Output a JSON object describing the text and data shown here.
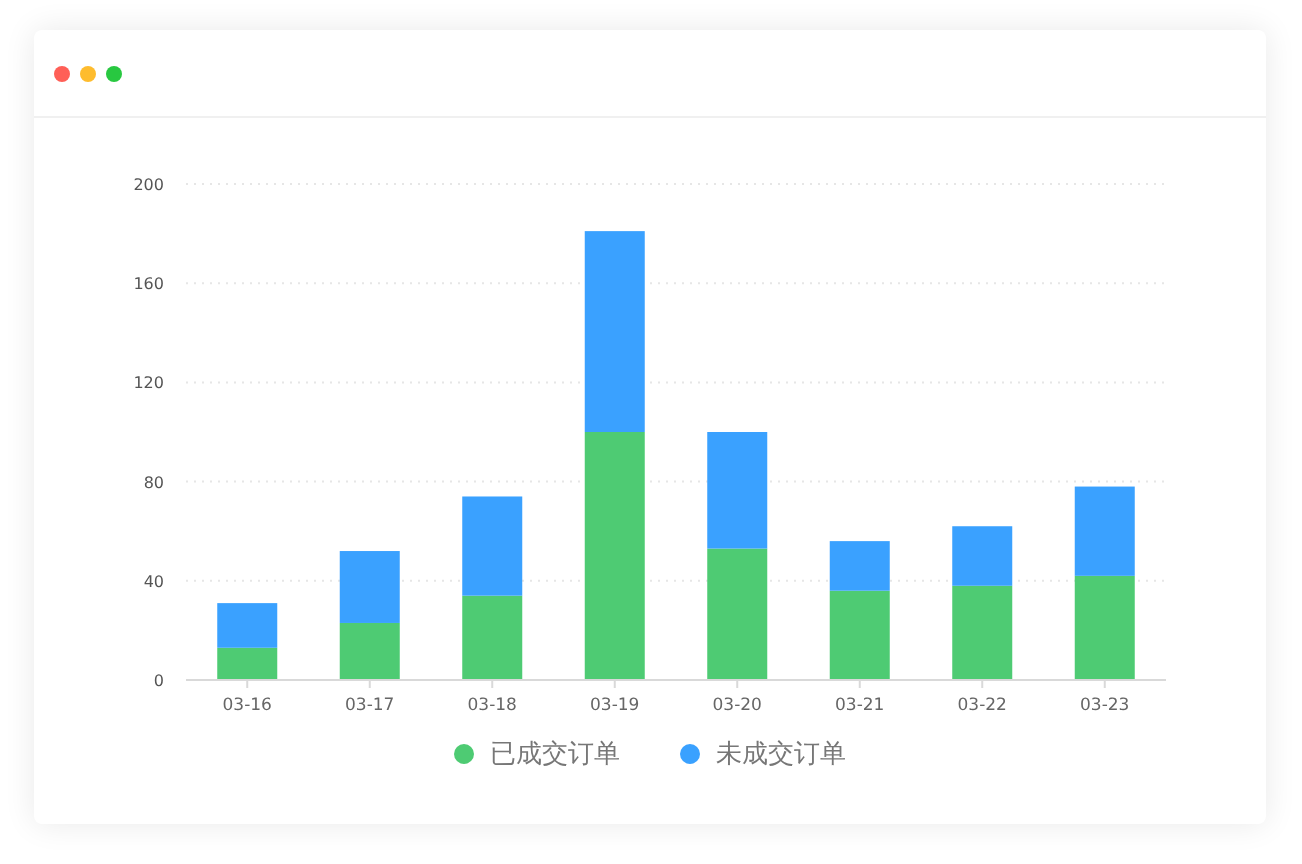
{
  "window": {
    "controls": [
      {
        "color": "#ff5f57"
      },
      {
        "color": "#febc2e"
      },
      {
        "color": "#28c840"
      }
    ]
  },
  "chart": {
    "chart_data": {
      "type": "bar",
      "stacked": true,
      "grid": true,
      "categories": [
        "03-16",
        "03-17",
        "03-18",
        "03-19",
        "03-20",
        "03-21",
        "03-22",
        "03-23"
      ],
      "ylim": [
        0,
        200
      ],
      "yticks": [
        0,
        40,
        80,
        120,
        160,
        200
      ],
      "series": [
        {
          "name": "已成交订单",
          "color": "#4ecb73",
          "values": [
            13,
            23,
            34,
            100,
            53,
            36,
            38,
            42
          ]
        },
        {
          "name": "未成交订单",
          "color": "#3aa1ff",
          "values": [
            18,
            29,
            40,
            81,
            47,
            20,
            24,
            36
          ]
        }
      ]
    }
  }
}
